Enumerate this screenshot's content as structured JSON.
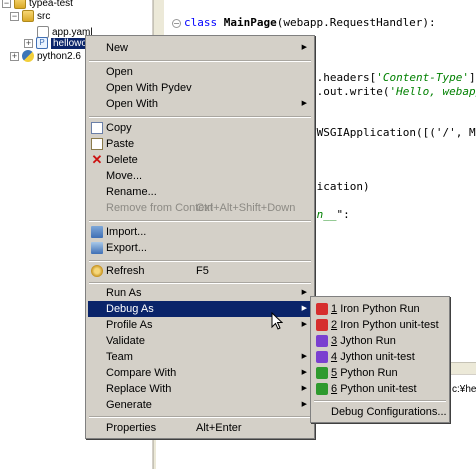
{
  "tree": {
    "project": "typea-test",
    "items": [
      {
        "name": "src",
        "toggle": "−"
      },
      {
        "name": "app.yaml"
      },
      {
        "name": "hellowor",
        "toggle": "+"
      },
      {
        "name": "python2.6",
        "toggle": "+"
      }
    ]
  },
  "editor": {
    "line1": {
      "kw": "class ",
      "name": "MainPage",
      "rest": "(webapp.RequestHandler):"
    },
    "line2": {
      "pre": "e.headers[",
      "str": "'Content-Type'",
      "post": "]"
    },
    "line3": {
      "pre": "e.out.write(",
      "str": "'Hello, webapp"
    },
    "line4": ".WSGIApplication([('/', Ma",
    "line5": "lication)",
    "line6": {
      "str": "in__",
      "post": "\":"
    },
    "path": "c:¥hello"
  },
  "context_menu": {
    "new": "New",
    "open": "Open",
    "open_with_pydev": "Open With Pydev",
    "open_with": "Open With",
    "copy": "Copy",
    "paste": "Paste",
    "delete": "Delete",
    "move": "Move...",
    "rename": "Rename...",
    "remove_from_context": "Remove from Context",
    "remove_from_context_shortcut": "Ctrl+Alt+Shift+Down",
    "import": "Import...",
    "export": "Export...",
    "refresh": "Refresh",
    "refresh_shortcut": "F5",
    "run_as": "Run As",
    "debug_as": "Debug As",
    "profile_as": "Profile As",
    "validate": "Validate",
    "team": "Team",
    "compare_with": "Compare With",
    "replace_with": "Replace With",
    "generate": "Generate",
    "properties": "Properties",
    "properties_shortcut": "Alt+Enter"
  },
  "debug_submenu": {
    "items": [
      {
        "num": "1",
        "label": "Iron Python Run",
        "color": "#d62e2e"
      },
      {
        "num": "2",
        "label": "Iron Python unit-test",
        "color": "#d62e2e"
      },
      {
        "num": "3",
        "label": "Jython Run",
        "color": "#7a3fd0"
      },
      {
        "num": "4",
        "label": "Jython unit-test",
        "color": "#7a3fd0"
      },
      {
        "num": "5",
        "label": "Python Run",
        "color": "#2e9a2e"
      },
      {
        "num": "6",
        "label": "Python unit-test",
        "color": "#2e9a2e"
      }
    ],
    "configurations": "Debug Configurations..."
  },
  "colors": {
    "selection": "#0a246a",
    "menu_bg": "#d4d0c8"
  }
}
